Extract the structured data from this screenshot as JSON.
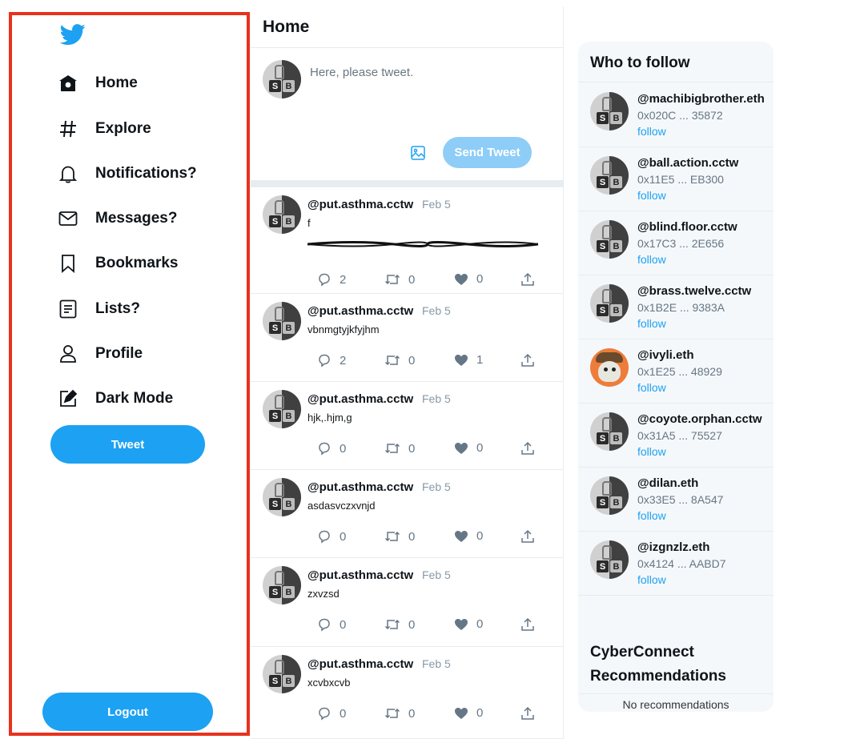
{
  "sidebar": {
    "nav": [
      {
        "label": "Home",
        "icon": "home-icon"
      },
      {
        "label": "Explore",
        "icon": "hashtag-icon"
      },
      {
        "label": "Notifications?",
        "icon": "bell-icon"
      },
      {
        "label": "Messages?",
        "icon": "envelope-icon"
      },
      {
        "label": "Bookmarks",
        "icon": "bookmark-icon"
      },
      {
        "label": "Lists?",
        "icon": "list-icon"
      },
      {
        "label": "Profile",
        "icon": "person-icon"
      },
      {
        "label": "Dark Mode",
        "icon": "edit-square-icon"
      }
    ],
    "tweet_button": "Tweet",
    "logout_button": "Logout"
  },
  "main": {
    "title": "Home",
    "compose_placeholder": "Here, please tweet.",
    "send_button": "Send Tweet",
    "tweets": [
      {
        "handle": "@put.asthma.cctw",
        "date": "Feb 5",
        "text": "f",
        "replies": "2",
        "retweets": "0",
        "likes": "0"
      },
      {
        "handle": "@put.asthma.cctw",
        "date": "Feb 5",
        "text": "vbnmgtyjkfyjhm",
        "replies": "2",
        "retweets": "0",
        "likes": "1"
      },
      {
        "handle": "@put.asthma.cctw",
        "date": "Feb 5",
        "text": "hjk,.hjm,g",
        "replies": "0",
        "retweets": "0",
        "likes": "0"
      },
      {
        "handle": "@put.asthma.cctw",
        "date": "Feb 5",
        "text": "asdasvczxvnjd",
        "replies": "0",
        "retweets": "0",
        "likes": "0"
      },
      {
        "handle": "@put.asthma.cctw",
        "date": "Feb 5",
        "text": "zxvzsd",
        "replies": "0",
        "retweets": "0",
        "likes": "0"
      },
      {
        "handle": "@put.asthma.cctw",
        "date": "Feb 5",
        "text": "xcvbxcvb",
        "replies": "0",
        "retweets": "0",
        "likes": "0"
      }
    ]
  },
  "right": {
    "title": "Who to follow",
    "follow_label": "follow",
    "suggestions": [
      {
        "name": "@machibigbrother.eth",
        "address": "0x020C ... 35872"
      },
      {
        "name": "@ball.action.cctw",
        "address": "0x11E5 ... EB300"
      },
      {
        "name": "@blind.floor.cctw",
        "address": "0x17C3 ... 2E656"
      },
      {
        "name": "@brass.twelve.cctw",
        "address": "0x1B2E ... 9383A"
      },
      {
        "name": "@ivyli.eth",
        "address": "0x1E25 ... 48929"
      },
      {
        "name": "@coyote.orphan.cctw",
        "address": "0x31A5 ... 75527"
      },
      {
        "name": "@dilan.eth",
        "address": "0x33E5 ... 8A547"
      },
      {
        "name": "@izgnzlz.eth",
        "address": "0x4124 ... AABD7"
      }
    ],
    "cc_title": "CyberConnect Recommendations",
    "no_recommendations": "No recommendations"
  },
  "colors": {
    "accent": "#1da1f2",
    "send_disabled": "#8ecdf7",
    "highlight_frame": "#e8321e"
  }
}
